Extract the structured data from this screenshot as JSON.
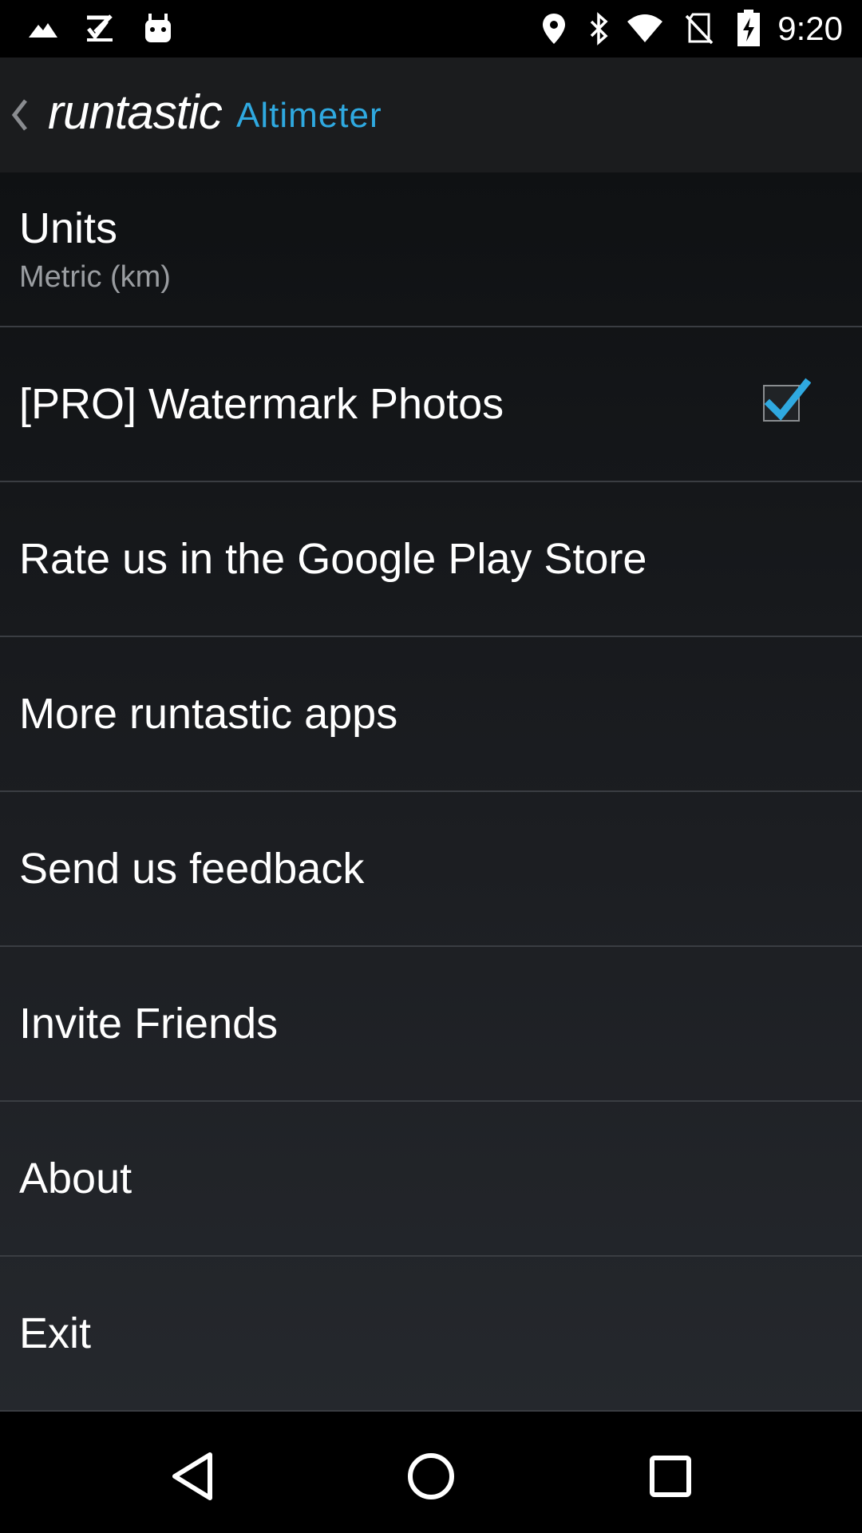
{
  "status_bar": {
    "time": "9:20",
    "left_icons": [
      "mountain-icon",
      "check-list-icon",
      "android-icon"
    ],
    "right_icons": [
      "location-icon",
      "bluetooth-icon",
      "wifi-icon",
      "no-sim-icon",
      "battery-charging-icon"
    ]
  },
  "action_bar": {
    "brand": "runtastic",
    "product": "Altimeter"
  },
  "settings": {
    "units": {
      "title": "Units",
      "summary": "Metric (km)"
    },
    "watermark": {
      "title": "[PRO] Watermark Photos",
      "checked": true
    },
    "rate": {
      "title": "Rate us in the Google Play Store"
    },
    "more_apps": {
      "title": "More runtastic apps"
    },
    "feedback": {
      "title": "Send us feedback"
    },
    "invite": {
      "title": "Invite Friends"
    },
    "about": {
      "title": "About"
    },
    "exit": {
      "title": "Exit"
    }
  },
  "nav_bar": {
    "icons": [
      "back-triangle-icon",
      "home-circle-icon",
      "recents-square-icon"
    ]
  },
  "colors": {
    "accent": "#2fa9e0",
    "action_bar": "#1b1c1e",
    "list_top": "#0f1113",
    "list_bottom": "#25282d",
    "divider": "#3a3d42",
    "summary_text": "#9a9da1"
  }
}
